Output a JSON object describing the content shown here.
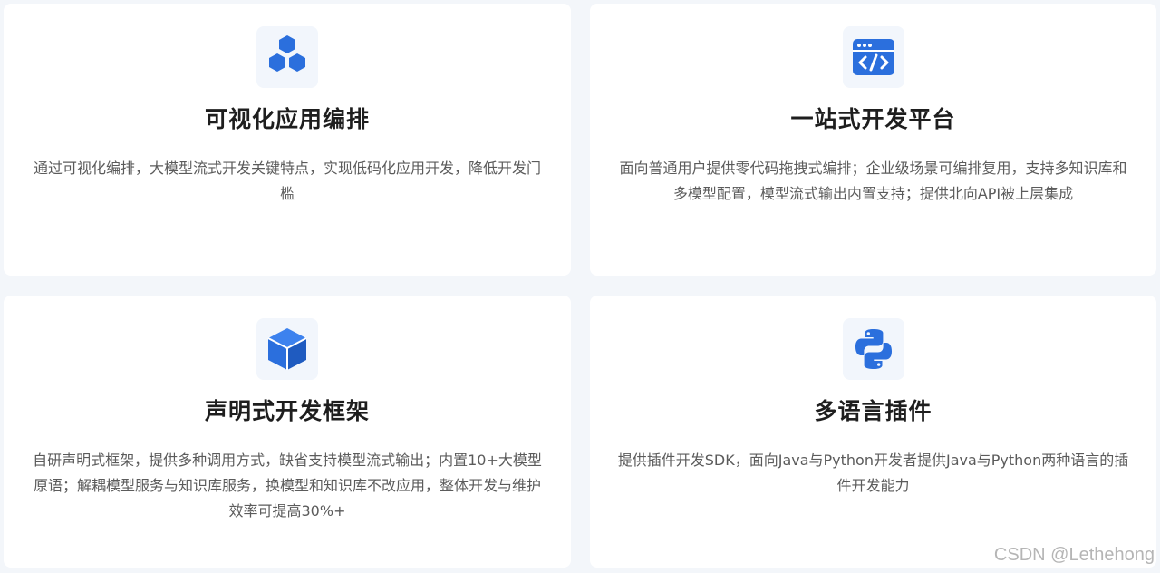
{
  "accent_color": "#2b6fdd",
  "background_color": "#f3f6fa",
  "cards": [
    {
      "icon": "hexagon-cluster-icon",
      "title": "可视化应用编排",
      "description": "通过可视化编排，大模型流式开发关键特点，实现低码化应用开发，降低开发门槛"
    },
    {
      "icon": "code-window-icon",
      "title": "一站式开发平台",
      "description": "面向普通用户提供零代码拖拽式编排；企业级场景可编排复用，支持多知识库和多模型配置，模型流式输出内置支持；提供北向API被上层集成"
    },
    {
      "icon": "cube-icon",
      "title": "声明式开发框架",
      "description": "自研声明式框架，提供多种调用方式，缺省支持模型流式输出；内置10+大模型原语；解耦模型服务与知识库服务，换模型和知识库不改应用，整体开发与维护效率可提高30%+"
    },
    {
      "icon": "python-logo-icon",
      "title": "多语言插件",
      "description": "提供插件开发SDK，面向Java与Python开发者提供Java与Python两种语言的插件开发能力"
    }
  ],
  "watermark": "CSDN @Lethehong"
}
